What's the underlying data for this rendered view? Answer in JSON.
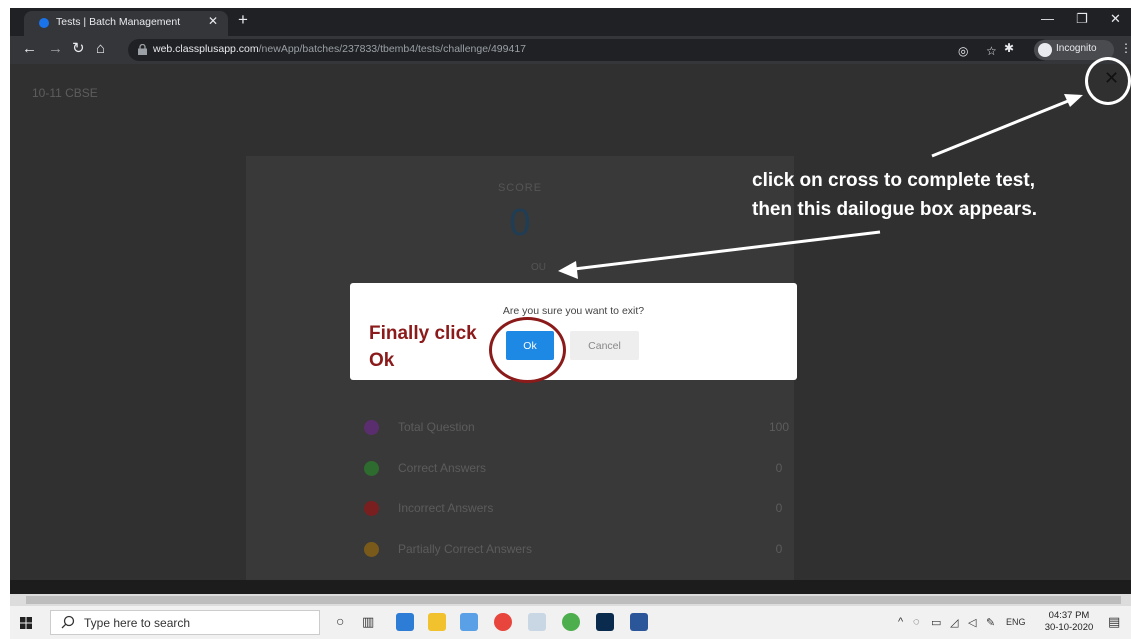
{
  "browser": {
    "tab_title": "Tests | Batch Management",
    "new_tab": "+",
    "url_domain": "web.classplusapp.com",
    "url_path": "/newApp/batches/237833/tbemb4/tests/challenge/499417",
    "incognito_label": "Incognito"
  },
  "page": {
    "course_name": "10-11 CBSE",
    "score_label": "SCORE",
    "score_value": "0",
    "score_sub": "OU",
    "stats": [
      {
        "label": "Total Question",
        "value": "100",
        "color": "#5a2e6e"
      },
      {
        "label": "Correct Answers",
        "value": "0",
        "color": "#2e6b2e"
      },
      {
        "label": "Incorrect Answers",
        "value": "0",
        "color": "#7a1f1f"
      },
      {
        "label": "Partially Correct Answers",
        "value": "0",
        "color": "#7a5a1a"
      }
    ]
  },
  "modal": {
    "message": "Are you sure you want to exit?",
    "ok_label": "Ok",
    "cancel_label": "Cancel"
  },
  "annotations": {
    "cross_note_line1": "click on cross to complete test,",
    "cross_note_line2": "then this dailogue box appears.",
    "finally_line1": "Finally click",
    "finally_line2": "Ok",
    "arrow_color": "#ffffff",
    "accent_color": "#8b1a1a"
  },
  "taskbar": {
    "search_placeholder": "Type here to search",
    "lang": "ENG",
    "time": "04:37 PM",
    "date": "30-10-2020"
  },
  "colors": {
    "chrome_dark": "#202124",
    "ok_blue": "#1e88e5"
  }
}
